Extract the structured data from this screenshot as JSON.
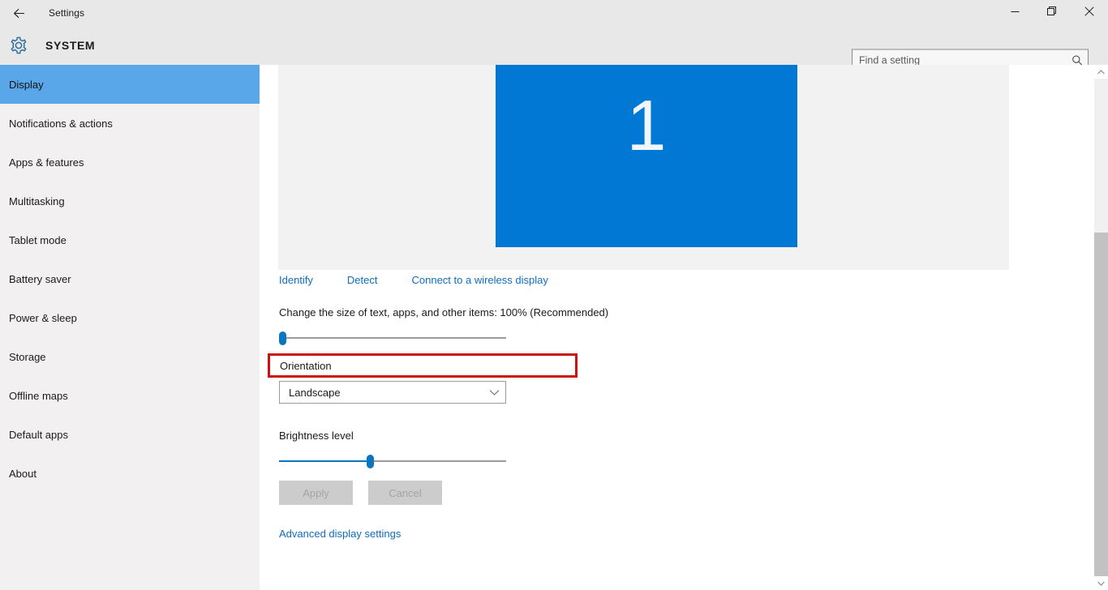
{
  "titlebar": {
    "back_icon": "back-arrow-icon",
    "title": "Settings",
    "minimize_icon": "minimize-icon",
    "maximize_icon": "maximize-icon",
    "close_icon": "close-icon"
  },
  "header": {
    "gear_icon": "gear-icon",
    "title": "SYSTEM",
    "search": {
      "value": "",
      "placeholder": "Find a setting",
      "icon": "search-icon"
    }
  },
  "sidebar": {
    "items": [
      {
        "label": "Display",
        "selected": true
      },
      {
        "label": "Notifications & actions",
        "selected": false
      },
      {
        "label": "Apps & features",
        "selected": false
      },
      {
        "label": "Multitasking",
        "selected": false
      },
      {
        "label": "Tablet mode",
        "selected": false
      },
      {
        "label": "Battery saver",
        "selected": false
      },
      {
        "label": "Power & sleep",
        "selected": false
      },
      {
        "label": "Storage",
        "selected": false
      },
      {
        "label": "Offline maps",
        "selected": false
      },
      {
        "label": "Default apps",
        "selected": false
      },
      {
        "label": "About",
        "selected": false
      }
    ]
  },
  "main": {
    "monitor_preview": {
      "display_number": "1",
      "color": "#0078d4"
    },
    "links": {
      "identify": "Identify",
      "detect": "Detect",
      "wireless": "Connect to a wireless display"
    },
    "scale": {
      "label": "Change the size of text, apps, and other items: 100% (Recommended)",
      "value": 0
    },
    "orientation": {
      "label": "Orientation",
      "selected": "Landscape",
      "chevron_icon": "chevron-down-icon",
      "highlight_color": "#cc1111"
    },
    "brightness": {
      "label": "Brightness level",
      "value": 40
    },
    "buttons": {
      "apply": "Apply",
      "cancel": "Cancel",
      "disabled": true
    },
    "advanced_link": "Advanced display settings"
  },
  "scrollbar": {
    "up_icon": "scroll-up-arrow-icon",
    "down_icon": "scroll-down-arrow-icon",
    "thumb_position": 0
  },
  "theme": {
    "accent": "#0078d4",
    "sidebar_selected": "#59a7e8",
    "link": "#0f6cbd",
    "chrome": "#e8e8e8"
  }
}
